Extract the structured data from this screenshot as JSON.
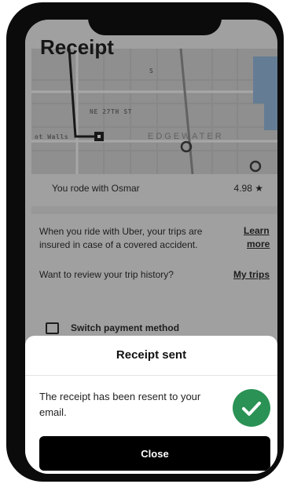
{
  "screen": {
    "title": "Receipt"
  },
  "map": {
    "street_ne27": "NE 27TH ST",
    "street_left": "ot Walls",
    "area": "EDGEWATER",
    "street_vertical": "S"
  },
  "driver": {
    "text": "You rode with Osmar",
    "rating": "4.98 ★"
  },
  "insurance": {
    "text": "When you ride with Uber, your trips are insured in case of a covered accident.",
    "link_line1": "Learn",
    "link_line2": "more"
  },
  "history": {
    "text": "Want to review your trip history?",
    "link": "My trips"
  },
  "payment": {
    "label": "Switch payment method",
    "icon": "wallet-icon"
  },
  "modal": {
    "title": "Receipt sent",
    "message": "The receipt has been resent to your email.",
    "close_label": "Close",
    "check_icon": "check-icon"
  },
  "colors": {
    "success": "#2a9254",
    "button": "#000000",
    "overlay": "rgba(35,35,35,0.40)"
  }
}
